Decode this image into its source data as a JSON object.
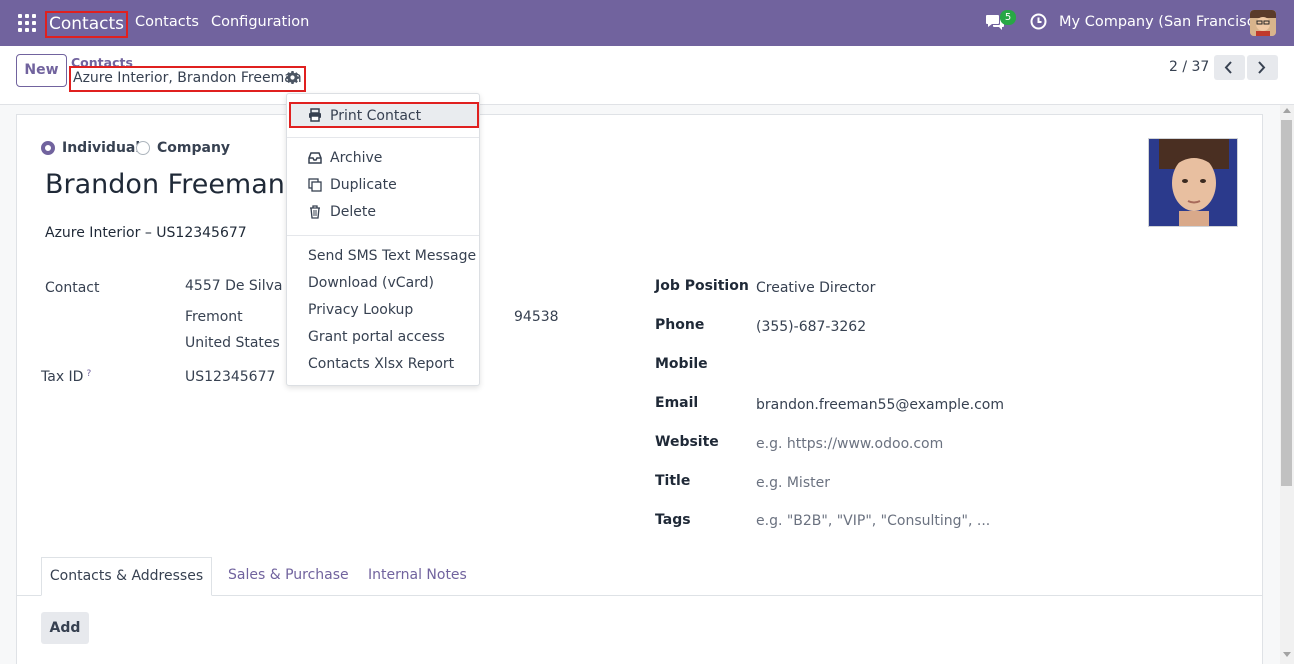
{
  "navbar": {
    "apps_icon": "grid-icon",
    "brand": "Contacts",
    "menu": [
      "Contacts",
      "Configuration"
    ],
    "chat_count": "5",
    "company": "My Company (San Francisco)",
    "color": "#71639e"
  },
  "control_panel": {
    "new_label": "New",
    "breadcrumb_parent": "Contacts",
    "breadcrumb_current": "Azure Interior, Brandon Freeman",
    "pager": "2 / 37"
  },
  "form": {
    "type_options": [
      "Individual",
      "Company"
    ],
    "selected_type": "Individual",
    "name": "Brandon Freeman",
    "company_line": "Azure Interior – US12345677",
    "contact_label": "Contact",
    "address": {
      "street": "4557 De Silva St",
      "city": "Fremont",
      "zip": "94538",
      "country": "United States"
    },
    "tax_id_label": "Tax ID",
    "tax_help": "?",
    "tax_id": "US12345677",
    "right_fields": [
      {
        "label": "Job Position",
        "value": "Creative Director",
        "placeholder": false
      },
      {
        "label": "Phone",
        "value": "(355)-687-3262",
        "placeholder": false
      },
      {
        "label": "Mobile",
        "value": "",
        "placeholder": false
      },
      {
        "label": "Email",
        "value": "brandon.freeman55@example.com",
        "placeholder": false
      },
      {
        "label": "Website",
        "value": "e.g. https://www.odoo.com",
        "placeholder": true
      },
      {
        "label": "Title",
        "value": "e.g. Mister",
        "placeholder": true
      },
      {
        "label": "Tags",
        "value": "e.g. \"B2B\", \"VIP\", \"Consulting\", ...",
        "placeholder": true
      }
    ]
  },
  "tabs": [
    "Contacts & Addresses",
    "Sales & Purchase",
    "Internal Notes"
  ],
  "add_label": "Add",
  "dropdown": {
    "print": {
      "label": "Print Contact",
      "icon": "print-icon"
    },
    "actions": [
      {
        "label": "Archive",
        "icon": "archive-icon"
      },
      {
        "label": "Duplicate",
        "icon": "duplicate-icon"
      },
      {
        "label": "Delete",
        "icon": "trash-icon"
      }
    ],
    "extra": [
      "Send SMS Text Message",
      "Download (vCard)",
      "Privacy Lookup",
      "Grant portal access",
      "Contacts Xlsx Report"
    ]
  }
}
